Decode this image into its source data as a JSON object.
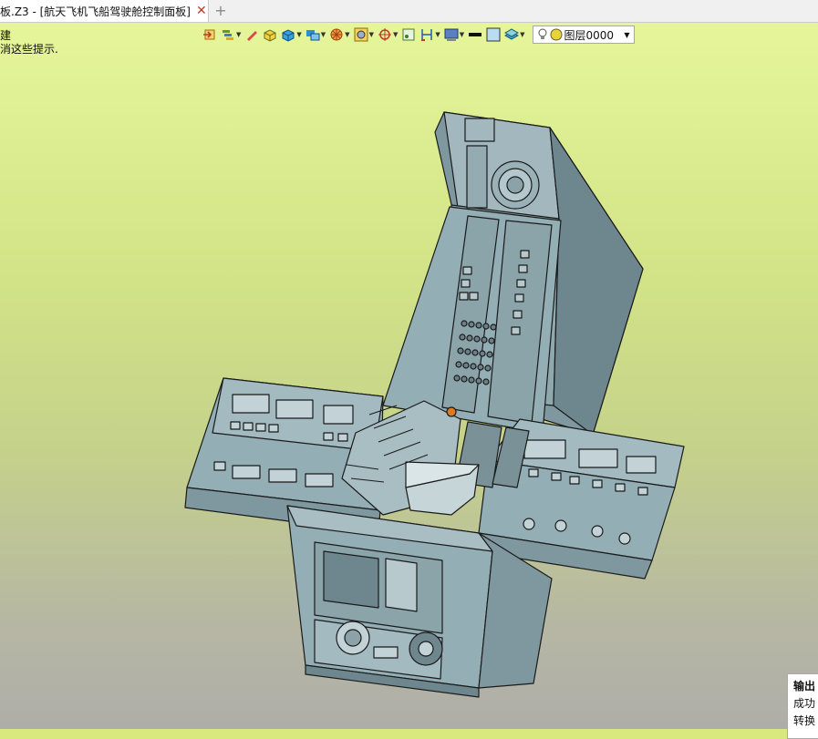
{
  "tab": {
    "title": "板.Z3 - [航天飞机飞船驾驶舱控制面板]",
    "close": "✕",
    "new": "+"
  },
  "hints": [
    "建",
    "消这些提示."
  ],
  "toolbar": {
    "icons": [
      "exit-icon",
      "layers-icon",
      "pen-icon",
      "yellow-solid-icon",
      "blue-box-icon",
      "blue-shape-icon",
      "wheel-icon",
      "frame-icon",
      "target-icon",
      "square-point-icon",
      "dimension-icon",
      "screen-icon",
      "black-line-icon",
      "color-square-icon",
      "stack-icon"
    ],
    "layer_label": "图层0000"
  },
  "output": {
    "title": "输出",
    "lines": [
      "成功",
      "转换"
    ]
  },
  "colors": {
    "model": "#93aeb4",
    "edge": "#1a1a1a",
    "viewport_top": "#e6f59a",
    "viewport_bottom": "#aeaea8"
  }
}
